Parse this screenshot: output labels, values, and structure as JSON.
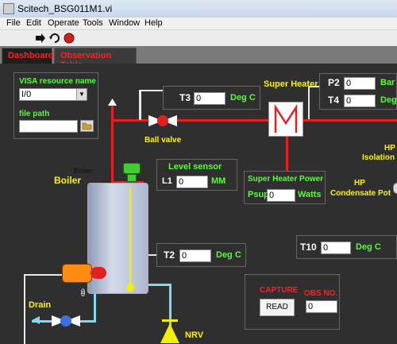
{
  "window": {
    "title": "Scitech_BSG011M1.vi"
  },
  "menu": [
    "File",
    "Edit",
    "Operate",
    "Tools",
    "Window",
    "Help"
  ],
  "tabs": [
    "Dashboard",
    "Observation Table"
  ],
  "visa": {
    "label": "VISA resource name",
    "value": "I/0",
    "file_label": "file path",
    "file_value": ""
  },
  "t3": {
    "label": "T3",
    "value": "0",
    "unit": "Deg C"
  },
  "super_heater": {
    "label": "Super Heater",
    "power_label": "Super Heater Power",
    "psup_label": "Psup",
    "psup_value": "0",
    "psup_unit": "Watts"
  },
  "p2": {
    "label": "P2",
    "value": "0",
    "unit": "Bar"
  },
  "t4": {
    "label": "T4",
    "value": "0",
    "unit": "Deg"
  },
  "ball_valve": "Ball valve",
  "hp_isolation": {
    "line1": "HP",
    "line2": "Isolation"
  },
  "hp_condensate": {
    "line1": "HP",
    "line2": "Condensate Pot"
  },
  "boiler": {
    "label": "Boiler",
    "small_label": "Boiler",
    "zero_label": "0"
  },
  "level": {
    "title": "Level sensor",
    "label": "L1",
    "value": "0",
    "unit": "MM"
  },
  "t2": {
    "label": "T2",
    "value": "0",
    "unit": "Deg C"
  },
  "t10": {
    "label": "T10",
    "value": "0",
    "unit": "Deg C"
  },
  "drain": "Drain",
  "nrv": "NRV",
  "capture": {
    "label": "CAPTURE",
    "button": "READ",
    "obs_label": "OBS NO.",
    "obs_value": "0"
  },
  "colors": {
    "pipe_hot": "#e12020",
    "pipe_cold": "#7fd9f0",
    "label_green": "#55ff33",
    "label_yellow": "#fff200",
    "tab_text": "#ff2020"
  }
}
